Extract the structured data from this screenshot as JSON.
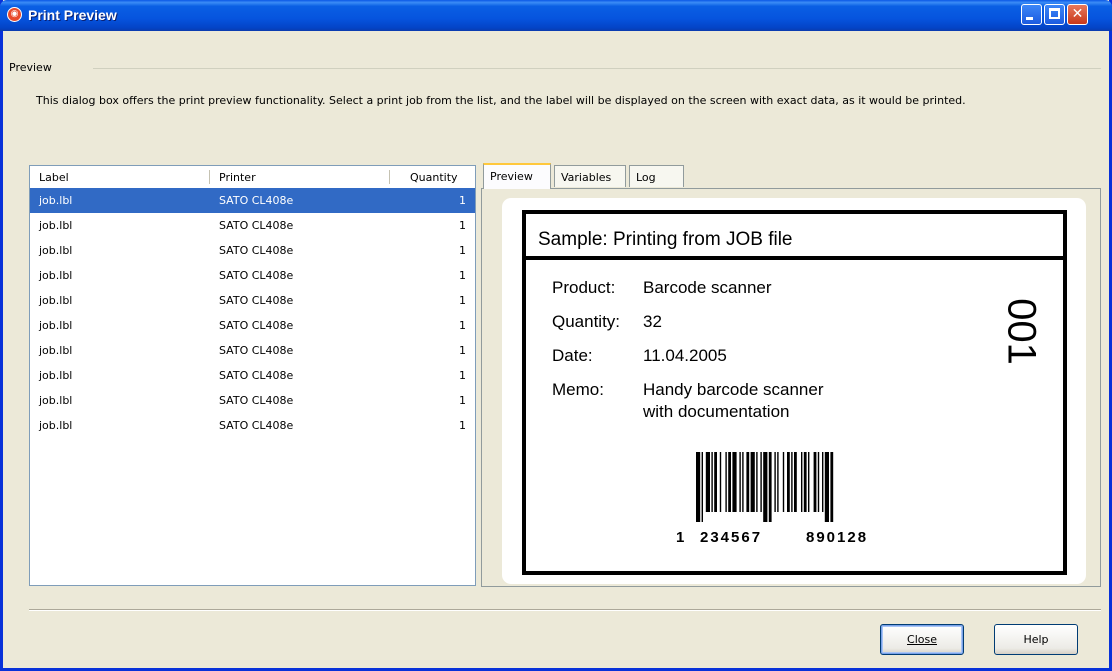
{
  "window": {
    "title": "Print Preview",
    "icon": "app-logo-icon",
    "controls": [
      "minimize",
      "maximize",
      "close"
    ]
  },
  "group": {
    "title": "Preview",
    "description": "This dialog box offers the print preview functionality. Select a print job from the list, and the label will be displayed on the screen with exact data, as it would be printed."
  },
  "joblist": {
    "columns": [
      "Label",
      "Printer",
      "Quantity"
    ],
    "rows": [
      {
        "label": "job.lbl",
        "printer": "SATO CL408e",
        "quantity": "1"
      },
      {
        "label": "job.lbl",
        "printer": "SATO CL408e",
        "quantity": "1"
      },
      {
        "label": "job.lbl",
        "printer": "SATO CL408e",
        "quantity": "1"
      },
      {
        "label": "job.lbl",
        "printer": "SATO CL408e",
        "quantity": "1"
      },
      {
        "label": "job.lbl",
        "printer": "SATO CL408e",
        "quantity": "1"
      },
      {
        "label": "job.lbl",
        "printer": "SATO CL408e",
        "quantity": "1"
      },
      {
        "label": "job.lbl",
        "printer": "SATO CL408e",
        "quantity": "1"
      },
      {
        "label": "job.lbl",
        "printer": "SATO CL408e",
        "quantity": "1"
      },
      {
        "label": "job.lbl",
        "printer": "SATO CL408e",
        "quantity": "1"
      },
      {
        "label": "job.lbl",
        "printer": "SATO CL408e",
        "quantity": "1"
      }
    ],
    "selected_index": 0
  },
  "tabs": [
    "Preview",
    "Variables",
    "Log"
  ],
  "active_tab": "Preview",
  "label_preview": {
    "heading": "Sample: Printing from JOB file",
    "fields": [
      {
        "name": "Product:",
        "value": "Barcode scanner"
      },
      {
        "name": "Quantity:",
        "value": "32"
      },
      {
        "name": "Date:",
        "value": "11.04.2005"
      },
      {
        "name": "Memo:",
        "value": "Handy barcode scanner"
      }
    ],
    "memo_line2": "with documentation",
    "serial": "001",
    "barcode_text": {
      "lead": "1",
      "left": "234567",
      "right": "890128"
    }
  },
  "buttons": {
    "close": "Close",
    "help": "Help"
  }
}
